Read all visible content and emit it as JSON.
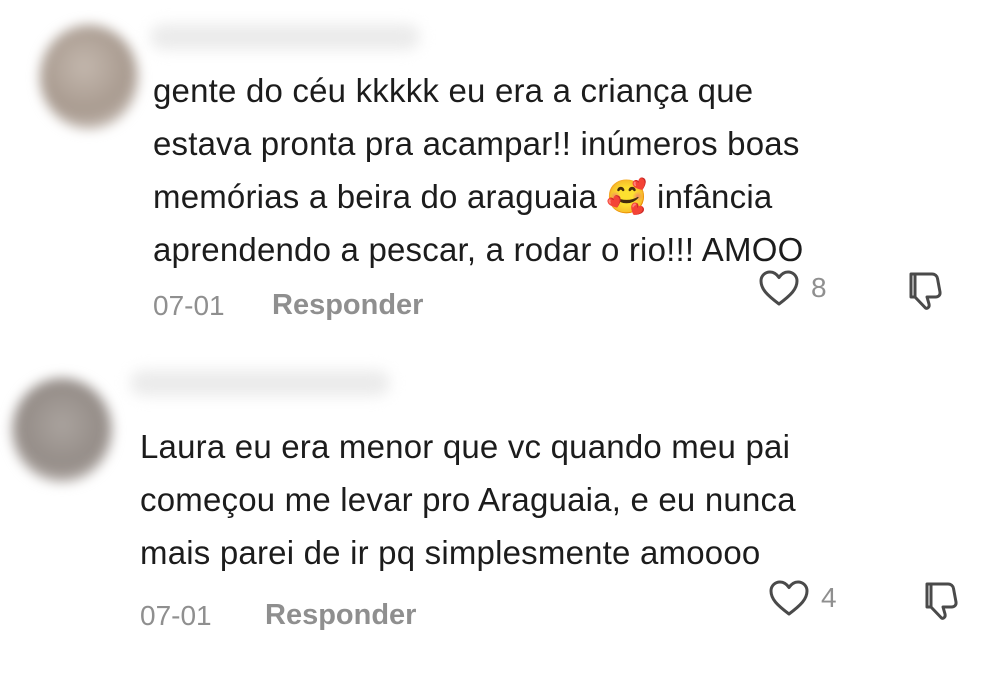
{
  "comments": [
    {
      "text": "gente do céu kkkkk eu era a criança que\nestava pronta pra acampar!! inúmeros boas\nmemórias a beira do araguaia ",
      "emoji": "🥰",
      "text_after": " infância\naprendendo a pescar, a rodar o rio!!! AMOO",
      "date": "07-01",
      "reply_label": "Responder",
      "like_count": "8"
    },
    {
      "text": "Laura eu era menor que vc quando meu pai\ncomeçou me levar pro Araguaia, e eu nunca\nmais parei de ir pq simplesmente amoooo",
      "date": "07-01",
      "reply_label": "Responder",
      "like_count": "4"
    }
  ],
  "colors": {
    "text": "#1c1c1c",
    "meta": "#8f8f8f",
    "icon": "#4a4a4a"
  },
  "icons": [
    "heart-icon",
    "dislike-icon"
  ]
}
